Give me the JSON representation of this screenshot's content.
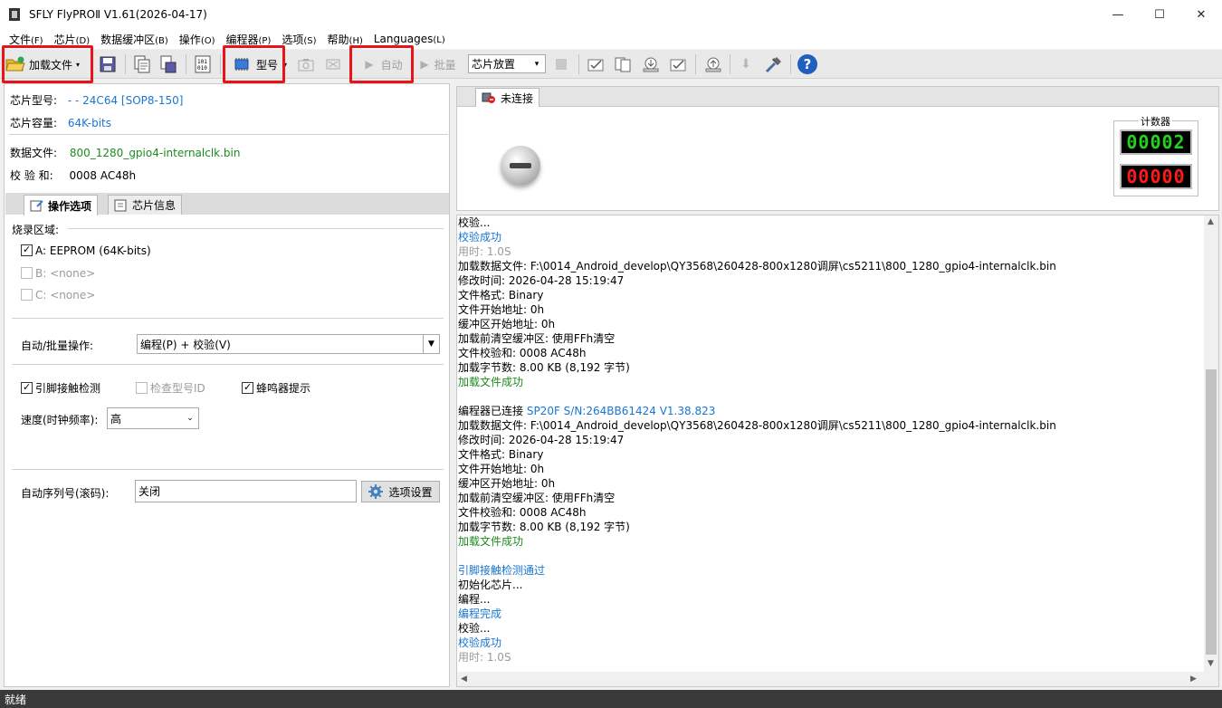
{
  "window": {
    "title": "SFLY FlyPROⅡ V1.61(2026-04-17)",
    "minimize": "—",
    "maximize": "☐",
    "close": "✕"
  },
  "menu": [
    {
      "label": "文件",
      "acc": "(F)"
    },
    {
      "label": "芯片",
      "acc": "(D)"
    },
    {
      "label": "数据缓冲区",
      "acc": "(B)"
    },
    {
      "label": "操作",
      "acc": "(O)"
    },
    {
      "label": "编程器",
      "acc": "(P)"
    },
    {
      "label": "选项",
      "acc": "(S)"
    },
    {
      "label": "帮助",
      "acc": "(H)"
    },
    {
      "label": "Languages",
      "acc": "(L)"
    }
  ],
  "toolbar": {
    "load_file": "加载文件",
    "model": "型号",
    "auto": "自动",
    "batch": "批量",
    "chip_place": "芯片放置",
    "bin_icon_text": "101\n010"
  },
  "annotations": [
    "1",
    "2",
    "3"
  ],
  "chip": {
    "type_label": "芯片型号:",
    "type_value": "- - 24C64 [SOP8-150]",
    "size_label": "芯片容量:",
    "size_value": "64K-bits",
    "data_file_label": "数据文件:",
    "data_file_value": "800_1280_gpio4-internalclk.bin",
    "checksum_label": "校 验 和:",
    "checksum_value": "0008 AC48h"
  },
  "tabs": {
    "options": "操作选项",
    "chip_info": "芯片信息"
  },
  "options": {
    "burn_area_label": "烧录区域:",
    "area_a": "A: EEPROM (64K-bits)",
    "area_b": "B: <none>",
    "area_c": "C: <none>",
    "auto_batch_label": "自动/批量操作:",
    "auto_batch_value": "编程(P) + 校验(V)",
    "pin_check": "引脚接触检测",
    "check_id": "检查型号ID",
    "buzzer": "蜂鸣器提示",
    "speed_label": "速度(时钟频率):",
    "speed_value": "高",
    "serial_label": "自动序列号(滚码):",
    "serial_value": "关闭",
    "settings_button": "选项设置"
  },
  "connection": {
    "tab_label": "未连接",
    "counter_label": "计数器",
    "counter_pass": "00002",
    "counter_fail": "00000",
    "pass_color": "#1fd31f",
    "fail_color": "#ff1a1a"
  },
  "log": [
    {
      "t": "校验...",
      "c": "#000000"
    },
    {
      "t": "校验成功",
      "c": "#1976d2"
    },
    {
      "t": "用时: 1.0S",
      "c": "#9a9a9a"
    },
    {
      "t": "加载数据文件: F:\\0014_Android_develop\\QY3568\\260428-800x1280调屏\\cs5211\\800_1280_gpio4-internalclk.bin",
      "c": "#000000"
    },
    {
      "t": "修改时间: 2026-04-28 15:19:47",
      "c": "#000000"
    },
    {
      "t": "文件格式: Binary",
      "c": "#000000"
    },
    {
      "t": "文件开始地址: 0h",
      "c": "#000000"
    },
    {
      "t": "缓冲区开始地址: 0h",
      "c": "#000000"
    },
    {
      "t": "加载前清空缓冲区:  使用FFh清空",
      "c": "#000000"
    },
    {
      "t": "文件校验和: 0008 AC48h",
      "c": "#000000"
    },
    {
      "t": "加载字节数: 8.00 KB (8,192 字节)",
      "c": "#000000"
    },
    {
      "t": "加载文件成功",
      "c": "#1e8a1e"
    },
    {
      "t": "",
      "c": "#000000"
    },
    {
      "t": "编程器已连接 ",
      "c": "#000000",
      "t2": "SP20F  S/N:264BB61424  V1.38.823",
      "c2": "#1976d2"
    },
    {
      "t": "加载数据文件: F:\\0014_Android_develop\\QY3568\\260428-800x1280调屏\\cs5211\\800_1280_gpio4-internalclk.bin",
      "c": "#000000"
    },
    {
      "t": "修改时间: 2026-04-28 15:19:47",
      "c": "#000000"
    },
    {
      "t": "文件格式: Binary",
      "c": "#000000"
    },
    {
      "t": "文件开始地址: 0h",
      "c": "#000000"
    },
    {
      "t": "缓冲区开始地址: 0h",
      "c": "#000000"
    },
    {
      "t": "加载前清空缓冲区:  使用FFh清空",
      "c": "#000000"
    },
    {
      "t": "文件校验和: 0008 AC48h",
      "c": "#000000"
    },
    {
      "t": "加载字节数: 8.00 KB (8,192 字节)",
      "c": "#000000"
    },
    {
      "t": "加载文件成功",
      "c": "#1e8a1e"
    },
    {
      "t": "",
      "c": "#000000"
    },
    {
      "t": "引脚接触检测通过",
      "c": "#1976d2"
    },
    {
      "t": "初始化芯片...",
      "c": "#000000"
    },
    {
      "t": "编程...",
      "c": "#000000"
    },
    {
      "t": "编程完成",
      "c": "#1976d2"
    },
    {
      "t": "校验...",
      "c": "#000000"
    },
    {
      "t": "校验成功",
      "c": "#1976d2"
    },
    {
      "t": "用时: 1.0S",
      "c": "#9a9a9a"
    }
  ],
  "statusbar": {
    "text": "就绪"
  }
}
